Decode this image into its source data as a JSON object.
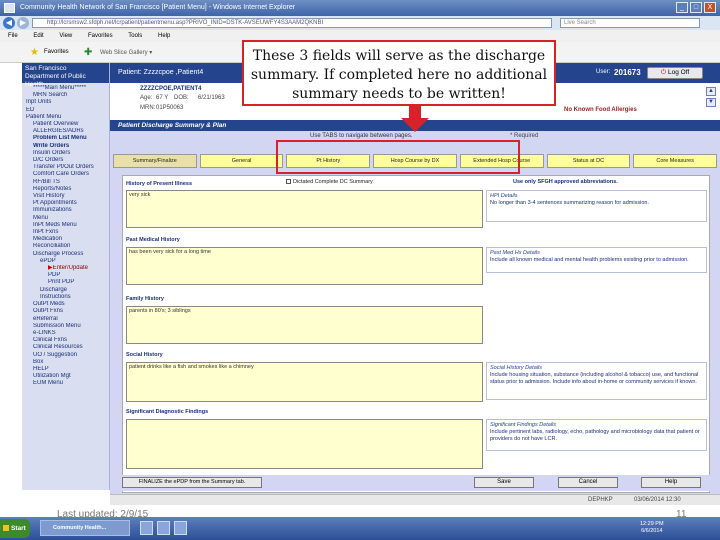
{
  "window": {
    "title": "Community Health Network of San Francisco [Patient Menu] - Windows Internet Explorer",
    "url": "http://lcrsmsw2.sfdph.net/lcrpatient/patientmenu.asp?PRIVO_INID=DSTK-AVSEUWFY4S3AAM2QKNBI",
    "search_placeholder": "Live Search",
    "controls": [
      "_",
      "□",
      "X"
    ]
  },
  "menubar": [
    "File",
    "Edit",
    "View",
    "Favorites",
    "Tools",
    "Help"
  ],
  "favbar": {
    "favorites_label": "Favorites",
    "web_slice_label": "Web Slice Gallery ▾"
  },
  "org": {
    "line1": "San Francisco",
    "line2": "Department of Public Health"
  },
  "nav": [
    {
      "label": "*****Main Menu*****",
      "level": 1
    },
    {
      "label": "MRN Search",
      "level": 1
    },
    {
      "label": "Inpt Units",
      "level": 0
    },
    {
      "label": "ED",
      "level": 0
    },
    {
      "label": "Patient Menu",
      "level": 0
    },
    {
      "label": "Patient Overview",
      "level": 1
    },
    {
      "label": "ALLERGIES/ADRs",
      "level": 1
    },
    {
      "label": "Problem List Menu",
      "level": 1,
      "bold": true
    },
    {
      "label": "Write Orders",
      "level": 1,
      "bold": true
    },
    {
      "label": "Insulin Orders",
      "level": 1
    },
    {
      "label": "D/C Orders",
      "level": 1
    },
    {
      "label": "Transfer Pt/Out Orders",
      "level": 1
    },
    {
      "label": "Comfort Care Orders",
      "level": 1
    },
    {
      "label": "RF/Bill TS",
      "level": 1
    },
    {
      "label": "Reports/Notes",
      "level": 1
    },
    {
      "label": "Visit History",
      "level": 1
    },
    {
      "label": "Pt Appointments",
      "level": 1
    },
    {
      "label": "Immunizations",
      "level": 1
    },
    {
      "label": "Menu",
      "level": 1
    },
    {
      "label": "InPt Meds Menu",
      "level": 1
    },
    {
      "label": "InPt Fxns",
      "level": 1
    },
    {
      "label": "Medication",
      "level": 1
    },
    {
      "label": "Reconciliation",
      "level": 1
    },
    {
      "label": "Discharge Process",
      "level": 1
    },
    {
      "label": "ePDP",
      "level": 2
    },
    {
      "label": "Enter/Update",
      "level": 3,
      "current": true
    },
    {
      "label": "PDP",
      "level": 3
    },
    {
      "label": "Print PDP",
      "level": 3
    },
    {
      "label": "Discharge",
      "level": 2
    },
    {
      "label": "Instructions",
      "level": 2
    },
    {
      "label": "OutPt Meds",
      "level": 1
    },
    {
      "label": "OutPt Fxns",
      "level": 1
    },
    {
      "label": "eReferral",
      "level": 1
    },
    {
      "label": "Submission Menu",
      "level": 1
    },
    {
      "label": "e-LINKS",
      "level": 1
    },
    {
      "label": "Clinical Fxns",
      "level": 1
    },
    {
      "label": "Clinical Resources",
      "level": 1
    },
    {
      "label": "UO / Suggestion",
      "level": 1
    },
    {
      "label": "Box",
      "level": 1
    },
    {
      "label": "HELP",
      "level": 1
    },
    {
      "label": "Utilization Mgt",
      "level": 1
    },
    {
      "label": "EUM Menu",
      "level": 1
    }
  ],
  "header": {
    "patient_text": "Patient: Zzzzcpoe ,Patient4",
    "user_label": "User:",
    "user_id": "201673",
    "logoff_label": "Log Off"
  },
  "patient": {
    "name": "ZZZZCPOE,PATIENT4",
    "age_label": "Age:",
    "age_value": "67 Y",
    "dob_label": "DOB:",
    "dob_value": "6/21/1963",
    "mrn_label": "MRN:",
    "mrn_value": "01P50063",
    "allergy_text": "No Known Food Allergies"
  },
  "panel": {
    "title": "Patient Discharge Summary & Plan",
    "hint": "Use TABS to navigate between pages.",
    "required": "* Required",
    "tabs": [
      "Summary/Finalize",
      "General",
      "Pt History",
      "Hosp Course by DX",
      "Extended Hosp Course",
      "Status at DC",
      "Core Measures"
    ],
    "abbrev_note": "Use only SFGH approved abbreviations.",
    "dictated_label": "Dictated Complete DC Summary",
    "sections": [
      {
        "label": "History of Present Illness",
        "value": "very sick",
        "help_title": "HPI Details",
        "help_text": "No longer than 3-4 sentences summarizing reason for admission."
      },
      {
        "label": "Past Medical History",
        "value": "has been very sick for a long time",
        "help_title": "Past Med Hx Details",
        "help_text": "Include all known medical and mental health problems existing prior to admission."
      },
      {
        "label": "Family History",
        "value": "parents in 80's; 3 siblings",
        "help_title": "",
        "help_text": ""
      },
      {
        "label": "Social History",
        "value": "patient drinks like a fish and smokes like a chimney",
        "help_title": "Social History Details",
        "help_text": "Include housing situation, substance (including alcohol & tobacco) use, and functional status prior to admission. Include info about in-home or community services if known."
      },
      {
        "label": "Significant Diagnostic Findings",
        "value": "",
        "help_title": "Significant Findings Details",
        "help_text": "Include pertinent labs, radiology, echo, pathology and microbiology data that patient or providers do not have LCR."
      }
    ],
    "finalize_label": "FINALIZE the ePDP from the Summary tab.",
    "save_label": "Save",
    "cancel_label": "Cancel",
    "help_label": "Help"
  },
  "statusbar": {
    "code": "DEPHKP",
    "time": "03/06/2014 12:30"
  },
  "taskbar": {
    "start_label": "Start",
    "task_label": "Community Health...",
    "tray_time": "12:29 PM",
    "tray_date": "6/6/2014"
  },
  "footer": {
    "last_updated": "Last updated: 2/9/15",
    "page_number": "11"
  },
  "callout": {
    "text": "These 3 fields will serve as the discharge summary. If completed here no additional summary needs to be written!"
  },
  "colors": {
    "header_navy": "#24448e",
    "panel_lavender": "#d2d6f2",
    "tab_yellow": "#ffff99",
    "field_yellow": "#ffffd0",
    "annotation_red": "#d6232a"
  }
}
